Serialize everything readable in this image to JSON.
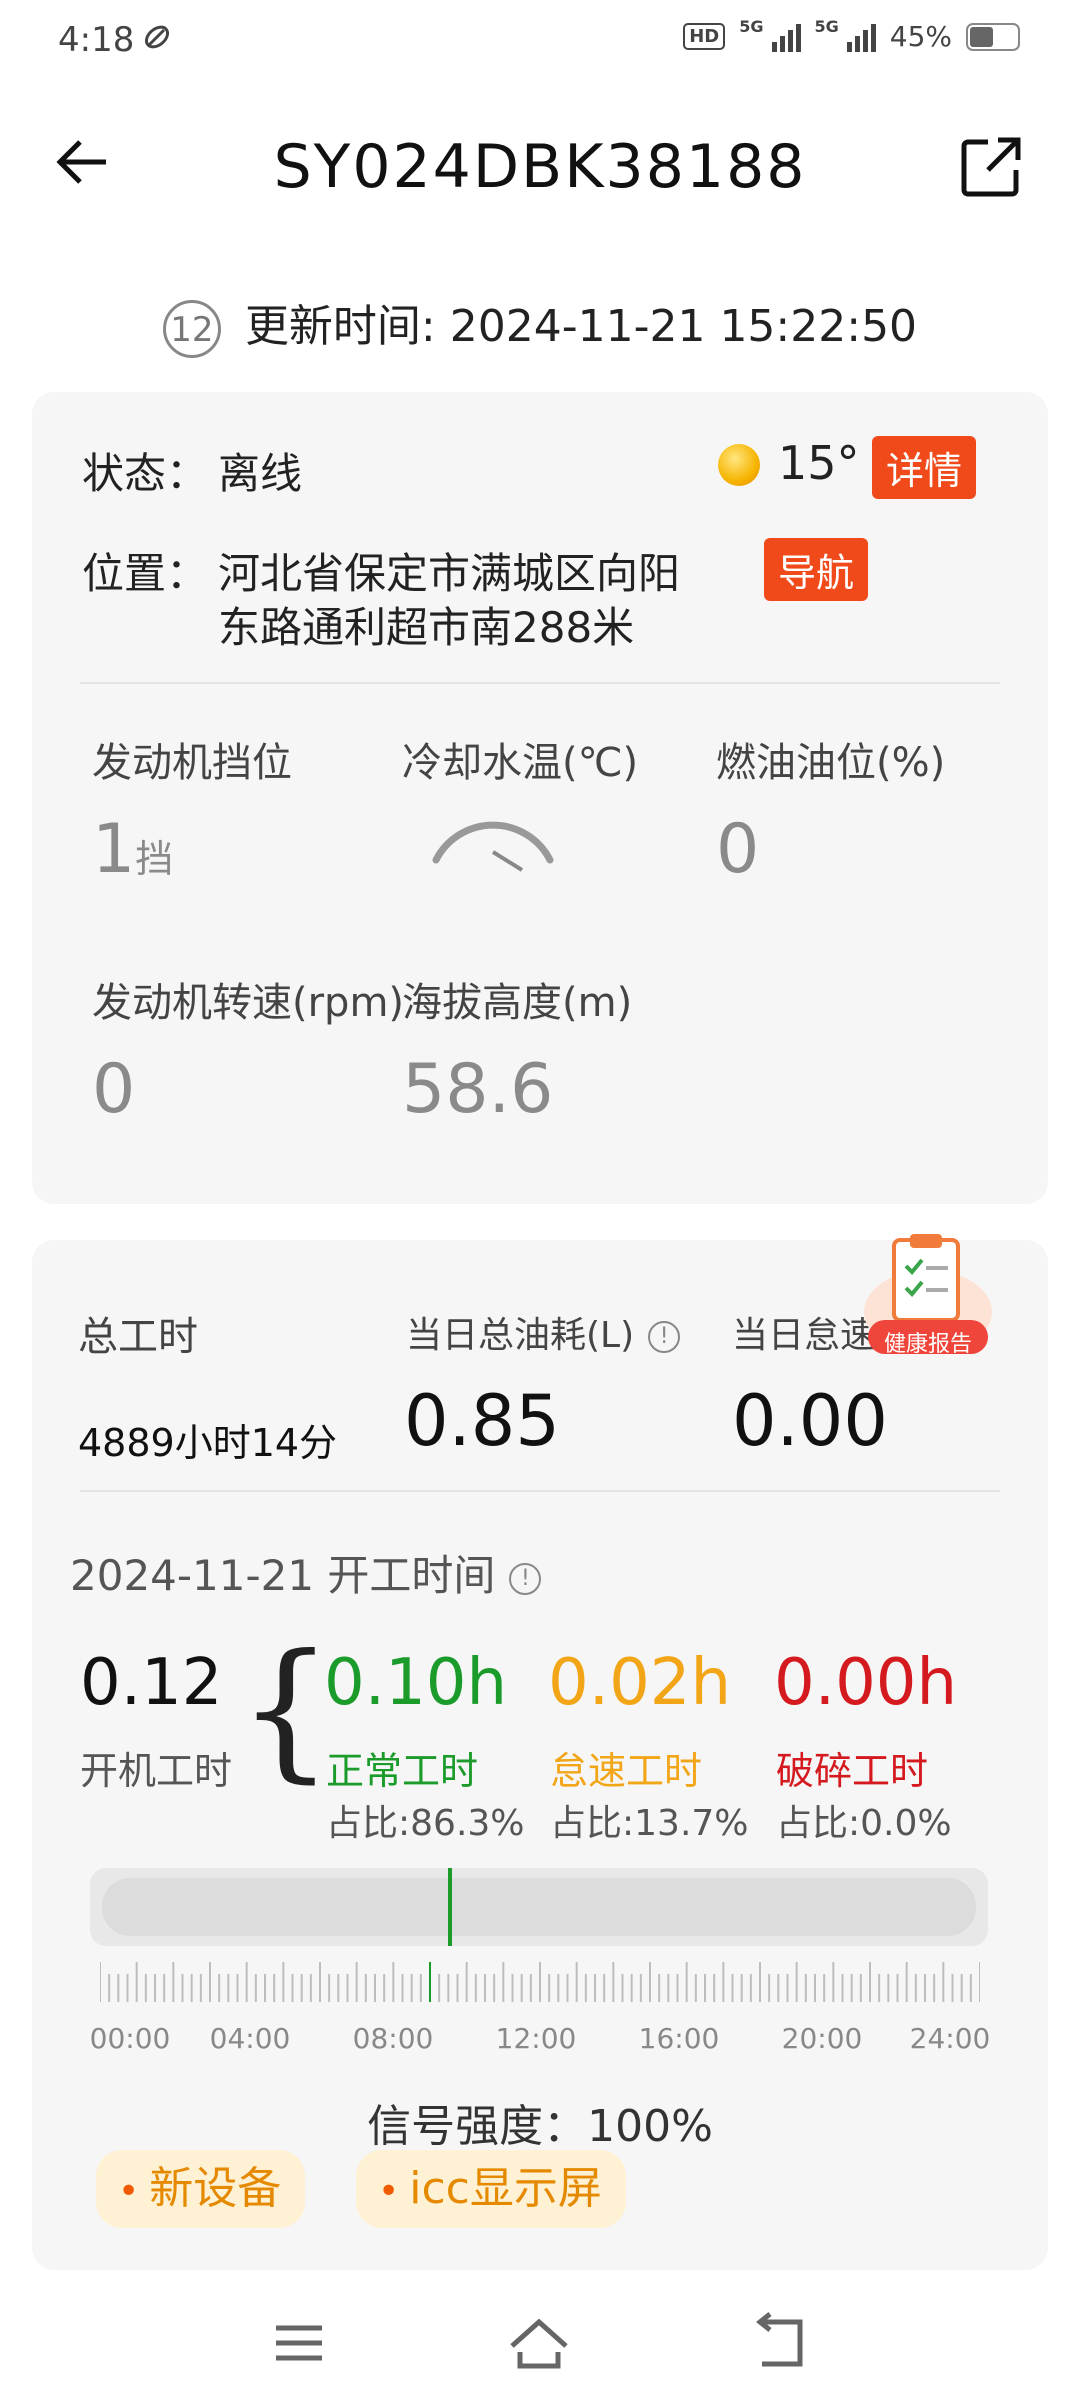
{
  "status_bar": {
    "time": "4:18",
    "hd": "HD",
    "net1": "5G",
    "net2": "5G",
    "battery": "45%"
  },
  "header": {
    "title": "SY024DBK38188"
  },
  "update": {
    "icon_text": "12",
    "label": "更新时间: 2024-11-21 15:22:50"
  },
  "card1": {
    "status_label": "状态：",
    "status_value": "离线",
    "temperature": "15°",
    "detail_button": "详情",
    "location_label": "位置：",
    "location_line1": "河北省保定市满城区向阳",
    "location_line2": "东路通利超市南288米",
    "nav_button": "导航",
    "metrics": [
      {
        "label": "发动机挡位",
        "value": "1",
        "unit": "挡"
      },
      {
        "label": "冷却水温(℃)",
        "value": ""
      },
      {
        "label": "燃油油位(%)",
        "value": "0"
      },
      {
        "label": "发动机转速(rpm)",
        "value": "0"
      },
      {
        "label": "海拔高度(m)",
        "value": "58.6"
      }
    ]
  },
  "card2": {
    "total_hours_label": "总工时",
    "total_hours_value": "4889小时14分",
    "fuel_label": "当日总油耗(L)",
    "fuel_value": "0.85",
    "idle_fuel_label": "当日怠速油",
    "idle_fuel_value": "0.00",
    "report_badge": "健康报告",
    "date_line": "2024-11-21 开工时间",
    "runtime_value": "0.12",
    "runtime_label": "开机工时",
    "segments": [
      {
        "value": "0.10h",
        "label": "正常工时",
        "ratio": "占比:86.3%",
        "color": "#1a9b2a"
      },
      {
        "value": "0.02h",
        "label": "怠速工时",
        "ratio": "占比:13.7%",
        "color": "#f2a516"
      },
      {
        "value": "0.00h",
        "label": "破碎工时",
        "ratio": "占比:0.0%",
        "color": "#d4191f"
      }
    ],
    "timeline_labels": [
      "00:00",
      "04:00",
      "08:00",
      "12:00",
      "16:00",
      "20:00",
      "24:00"
    ],
    "signal": "信号强度：100%",
    "chips": [
      "新设备",
      "icc显示屏"
    ]
  }
}
